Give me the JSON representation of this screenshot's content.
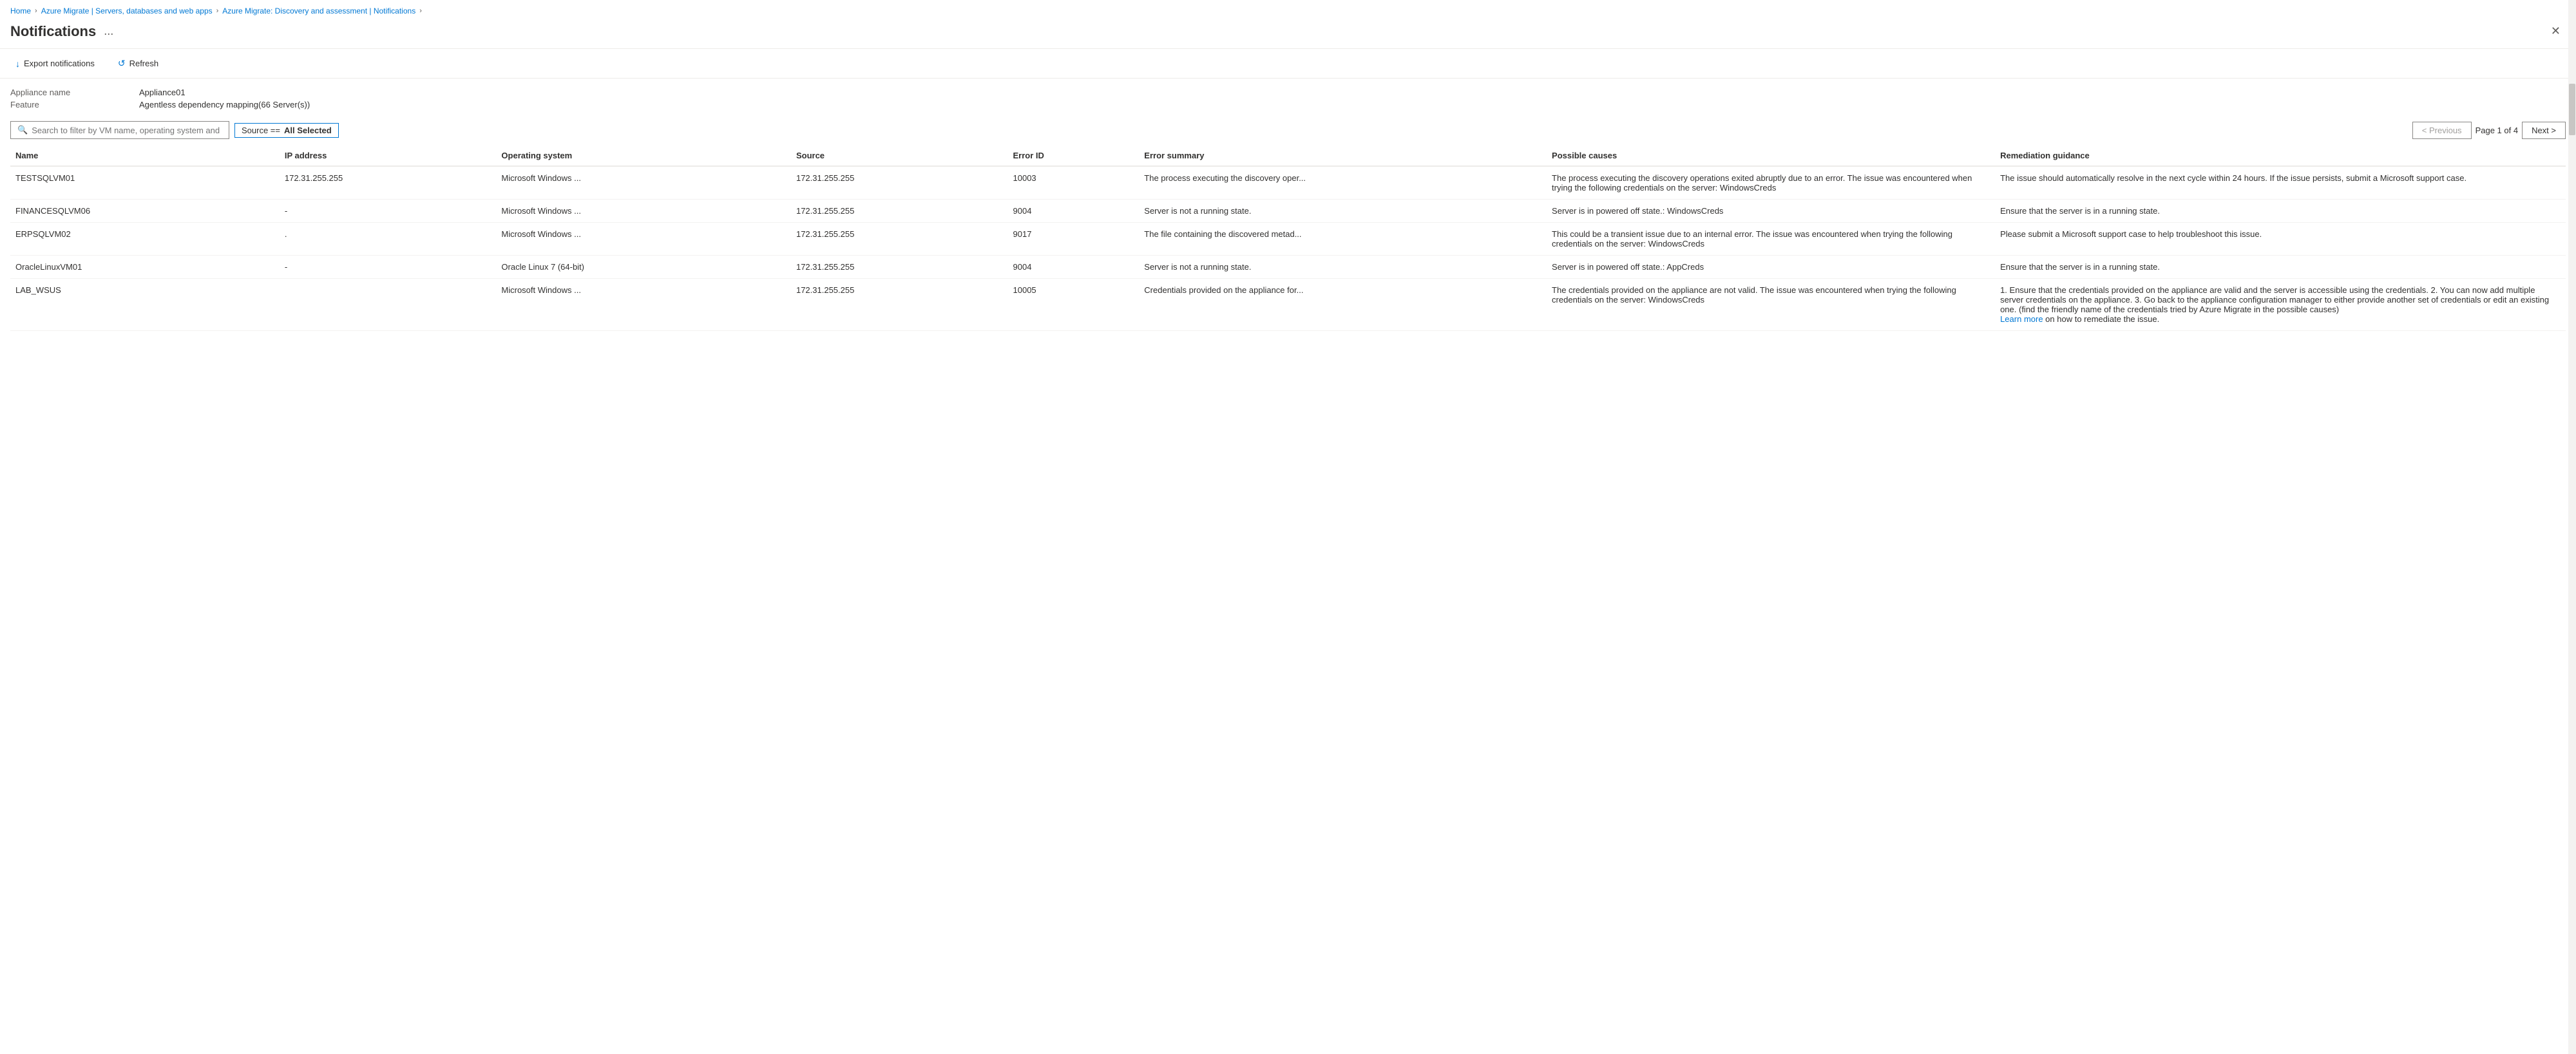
{
  "breadcrumb": {
    "items": [
      {
        "label": "Home",
        "href": true
      },
      {
        "label": "Azure Migrate | Servers, databases and web apps",
        "href": true
      },
      {
        "label": "Azure Migrate: Discovery and assessment | Notifications",
        "href": true
      }
    ]
  },
  "header": {
    "title": "Notifications",
    "dots_label": "...",
    "close_label": "✕"
  },
  "toolbar": {
    "export_label": "Export notifications",
    "refresh_label": "Refresh"
  },
  "meta": {
    "appliance_name_label": "Appliance name",
    "appliance_name_value": "Appliance01",
    "feature_label": "Feature",
    "feature_value": "Agentless dependency mapping(66 Server(s))"
  },
  "search": {
    "placeholder": "Search to filter by VM name, operating system and error ID"
  },
  "filter_tag": {
    "label": "Source ==",
    "value": "All Selected"
  },
  "pagination": {
    "previous_label": "< Previous",
    "next_label": "Next >",
    "page_info": "Page 1 of 4"
  },
  "table": {
    "columns": [
      "Name",
      "IP address",
      "Operating system",
      "Source",
      "Error ID",
      "Error summary",
      "Possible causes",
      "Remediation guidance"
    ],
    "rows": [
      {
        "name": "TESTSQLVM01",
        "ip": "172.31.255.255",
        "os": "Microsoft Windows ...",
        "source": "172.31.255.255",
        "error_id": "10003",
        "error_summary": "The process executing the discovery oper...",
        "possible_causes": "The process executing the discovery operations exited abruptly due to an error. The issue was encountered when trying the following credentials on the server: WindowsCreds",
        "remediation": "The issue should automatically resolve in the next cycle within 24 hours. If the issue persists, submit a Microsoft support case."
      },
      {
        "name": "FINANCESQLVM06",
        "ip": "-",
        "os": "Microsoft Windows ...",
        "source": "172.31.255.255",
        "error_id": "9004",
        "error_summary": "Server is not a running state.",
        "possible_causes": "Server is in powered off state.: WindowsCreds",
        "remediation": "Ensure that the server is in a running state."
      },
      {
        "name": "ERPSQLVM02",
        "ip": ".",
        "os": "Microsoft Windows ...",
        "source": "172.31.255.255",
        "error_id": "9017",
        "error_summary": "The file containing the discovered metad...",
        "possible_causes": "This could be a transient issue due to an internal error. The issue was encountered when trying the following credentials on the server: WindowsCreds",
        "remediation": "Please submit a Microsoft support case to help troubleshoot this issue."
      },
      {
        "name": "OracleLinuxVM01",
        "ip": "-",
        "os": "Oracle Linux 7 (64-bit)",
        "source": "172.31.255.255",
        "error_id": "9004",
        "error_summary": "Server is not a running state.",
        "possible_causes": "Server is in powered off state.: AppCreds",
        "remediation": "Ensure that the server is in a running state."
      },
      {
        "name": "LAB_WSUS",
        "ip": "",
        "os": "Microsoft Windows ...",
        "source": "172.31.255.255",
        "error_id": "10005",
        "error_summary": "Credentials provided on the appliance for...",
        "possible_causes": "The credentials provided on the appliance are not valid. The issue was encountered when trying the following credentials on the server: WindowsCreds",
        "remediation": "1. Ensure that the credentials provided on the appliance are valid and the server is accessible using the credentials.\n2. You can now add multiple server credentials on the appliance.\n3. Go back to the appliance configuration manager to either provide another set of credentials or edit an existing one. (find the friendly name of the credentials tried by Azure Migrate in the possible causes)",
        "remediation_link": "Learn more",
        "remediation_link_suffix": " on how to remediate the issue."
      }
    ]
  }
}
